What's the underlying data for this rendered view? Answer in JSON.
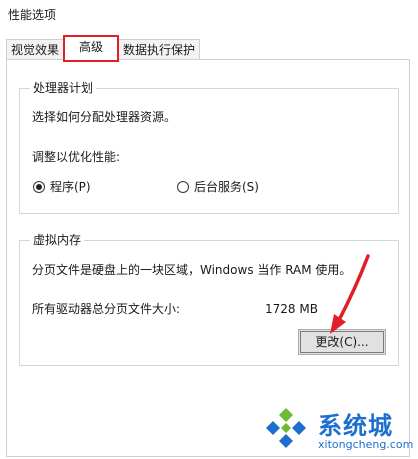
{
  "window": {
    "title": "性能选项"
  },
  "tabs": [
    {
      "label": "视觉效果",
      "active": false
    },
    {
      "label": "高级",
      "active": true
    },
    {
      "label": "数据执行保护",
      "active": false
    }
  ],
  "processor": {
    "group_label": "处理器计划",
    "description": "选择如何分配处理器资源。",
    "adjust_label": "调整以优化性能:",
    "option_programs": "程序(P)",
    "option_background": "后台服务(S)",
    "selected": "programs"
  },
  "virtual_memory": {
    "group_label": "虚拟内存",
    "description": "分页文件是硬盘上的一块区域，Windows 当作 RAM 使用。",
    "total_label": "所有驱动器总分页文件大小:",
    "total_value": "1728 MB",
    "change_button": "更改(C)..."
  },
  "watermark": {
    "brand_cn": "系统城",
    "brand_en": "xitongcheng.com"
  },
  "colors": {
    "highlight_red": "#e21f26",
    "watermark_blue": "#1c6fd0",
    "watermark_green": "#6dbb33"
  }
}
